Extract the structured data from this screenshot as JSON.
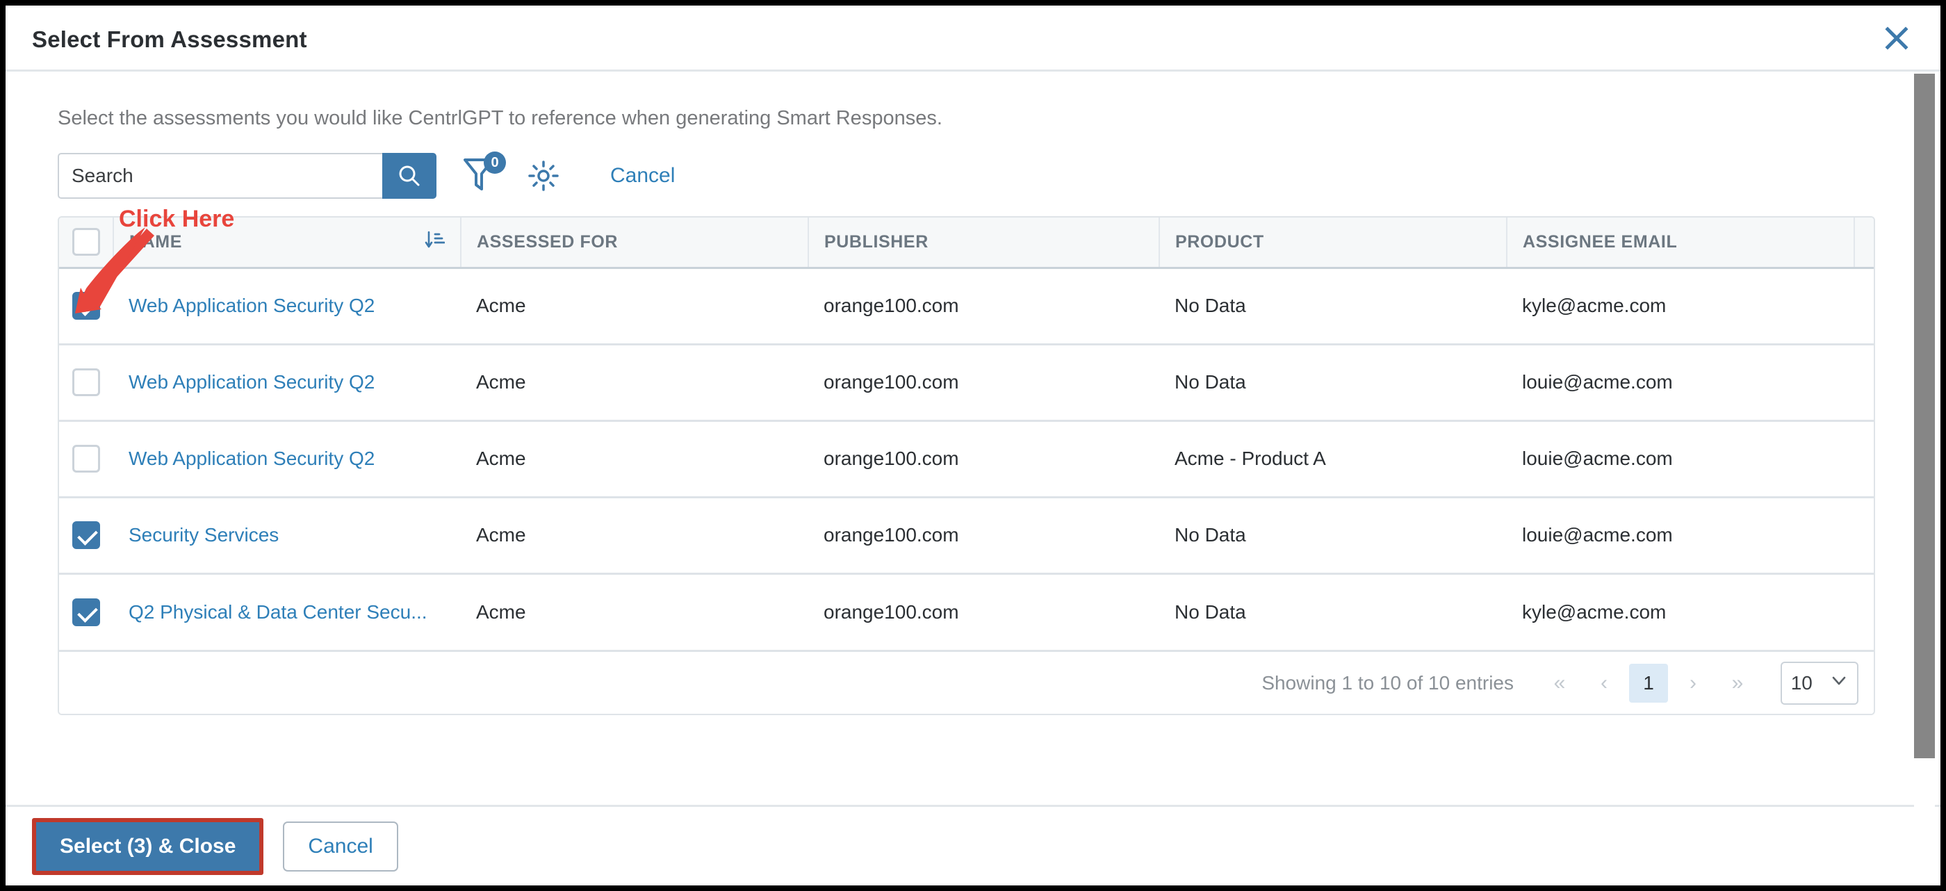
{
  "modal": {
    "title": "Select From Assessment",
    "close_icon": "close-icon",
    "intro": "Select the assessments you would like CentrlGPT to reference when generating Smart Responses."
  },
  "toolbar": {
    "search_placeholder": "Search",
    "search_value": "",
    "search_icon": "search-icon",
    "filter_icon": "filter-funnel-icon",
    "filter_badge": "0",
    "settings_icon": "gear-icon",
    "cancel_label": "Cancel"
  },
  "table": {
    "columns": [
      {
        "key": "name",
        "label": "NAME",
        "sort_icon": "sort-descending-icon"
      },
      {
        "key": "assessed_for",
        "label": "ASSESSED FOR"
      },
      {
        "key": "publisher",
        "label": "PUBLISHER"
      },
      {
        "key": "product",
        "label": "PRODUCT"
      },
      {
        "key": "assignee_email",
        "label": "ASSIGNEE EMAIL"
      }
    ],
    "select_all_checked": false,
    "rows": [
      {
        "checked": true,
        "name": "Web Application Security Q2",
        "assessed_for": "Acme",
        "publisher": "orange100.com",
        "product": "No Data",
        "assignee_email": "kyle@acme.com"
      },
      {
        "checked": false,
        "name": "Web Application Security Q2",
        "assessed_for": "Acme",
        "publisher": "orange100.com",
        "product": "No Data",
        "assignee_email": "louie@acme.com"
      },
      {
        "checked": false,
        "name": "Web Application Security Q2",
        "assessed_for": "Acme",
        "publisher": "orange100.com",
        "product": "Acme - Product A",
        "assignee_email": "louie@acme.com"
      },
      {
        "checked": true,
        "name": "Security Services",
        "assessed_for": "Acme",
        "publisher": "orange100.com",
        "product": "No Data",
        "assignee_email": "louie@acme.com"
      },
      {
        "checked": true,
        "name": "Q2 Physical & Data Center Secu...",
        "assessed_for": "Acme",
        "publisher": "orange100.com",
        "product": "No Data",
        "assignee_email": "kyle@acme.com"
      }
    ]
  },
  "pagination": {
    "showing": "Showing 1 to 10 of 10 entries",
    "first_label": "«",
    "prev_label": "‹",
    "current_page": "1",
    "next_label": "›",
    "last_label": "»",
    "page_size": "10",
    "page_size_chevron": "chevron-down-icon"
  },
  "footer": {
    "primary_label": "Select (3) & Close",
    "secondary_label": "Cancel"
  },
  "annotation": {
    "label": "Click Here",
    "color": "#e8453c"
  },
  "colors": {
    "accent_blue": "#3d79ab",
    "link_blue": "#2e7fb8",
    "annotation_red": "#e8453c",
    "header_bg": "#f6f8f9",
    "border": "#dee3e8"
  }
}
